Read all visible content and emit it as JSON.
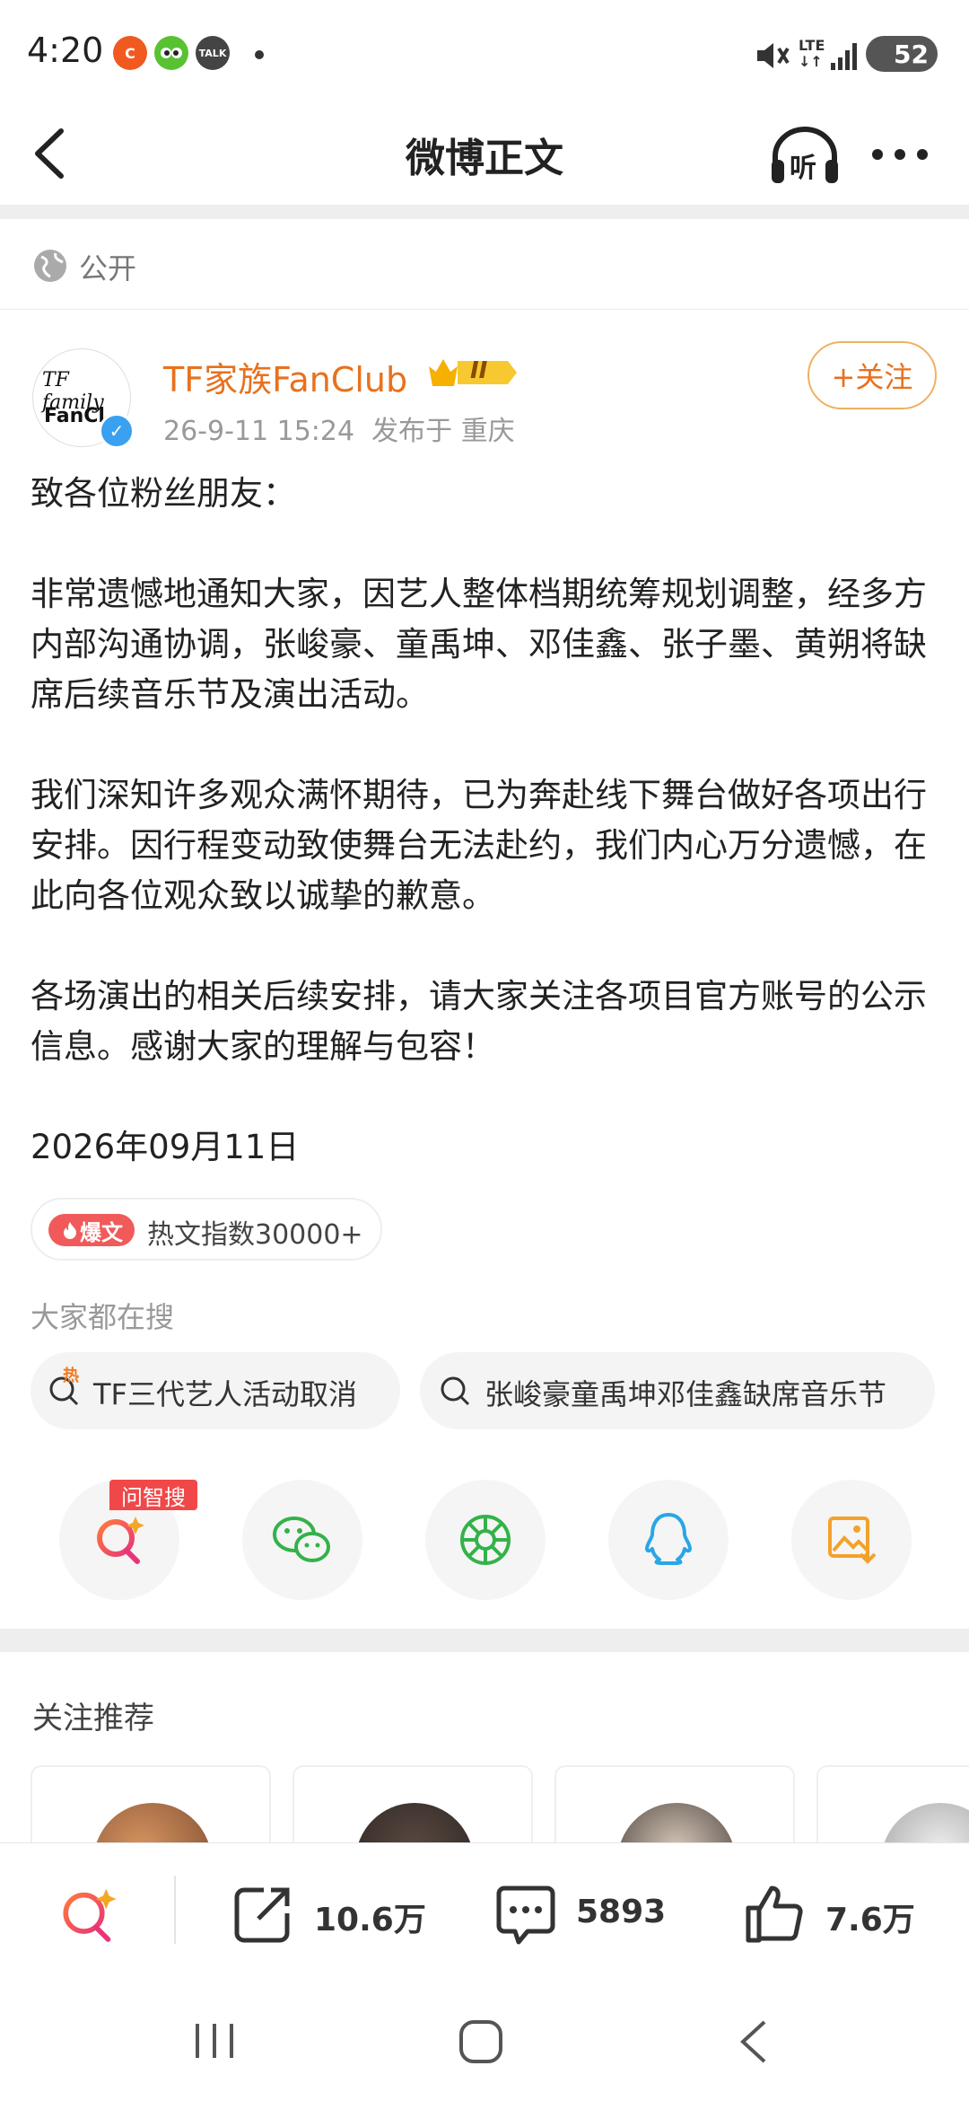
{
  "status_bar": {
    "time": "4:20",
    "app_icons": [
      "c-app-icon",
      "duolingo-icon",
      "talk-icon"
    ],
    "network": "LTE",
    "battery": "52"
  },
  "nav": {
    "title": "微博正文",
    "listen_label": "听"
  },
  "visibility": {
    "label": "公开"
  },
  "author": {
    "name": "TF家族FanClub",
    "avatar_line1": "TF family",
    "avatar_line2": "FanCl",
    "vip_level": "II",
    "date": "26-9-11 15:24",
    "location": "发布于 重庆",
    "follow_label": "+关注"
  },
  "post": {
    "paragraphs": [
      "致各位粉丝朋友：",
      "非常遗憾地通知大家，因艺人整体档期统筹规划调整，经多方内部沟通协调，张峻豪、童禹坤、邓佳鑫、张子墨、黄朔将缺席后续音乐节及演出活动。",
      "我们深知许多观众满怀期待，已为奔赴线下舞台做好各项出行安排。因行程变动致使舞台无法赴约，我们内心万分遗憾，在此向各位观众致以诚挚的歉意。",
      "各场演出的相关后续安排，请大家关注各项目官方账号的公示信息。感谢大家的理解与包容！",
      "2026年09月11日"
    ]
  },
  "hot": {
    "tag": "爆文",
    "text": "热文指数30000+"
  },
  "search": {
    "heading": "大家都在搜",
    "items": [
      {
        "text": "TF三代艺人活动取消",
        "hot_mark": "热"
      },
      {
        "text": "张峻豪童禹坤邓佳鑫缺席音乐节"
      }
    ]
  },
  "share": {
    "wenzhisou_tag": "问智搜",
    "items": [
      "wenzhisou-search-icon",
      "wechat-icon",
      "moments-icon",
      "qq-icon",
      "save-image-icon"
    ]
  },
  "recommend": {
    "title": "关注推荐"
  },
  "actions": {
    "repost": "10.6万",
    "comment": "5893",
    "like": "7.6万"
  },
  "colors": {
    "accent": "#e8711e",
    "hot_red": "#f05a5a",
    "wechat_green": "#33b24a",
    "qq_blue": "#2aa6e6",
    "save_orange": "#f2a22a"
  }
}
